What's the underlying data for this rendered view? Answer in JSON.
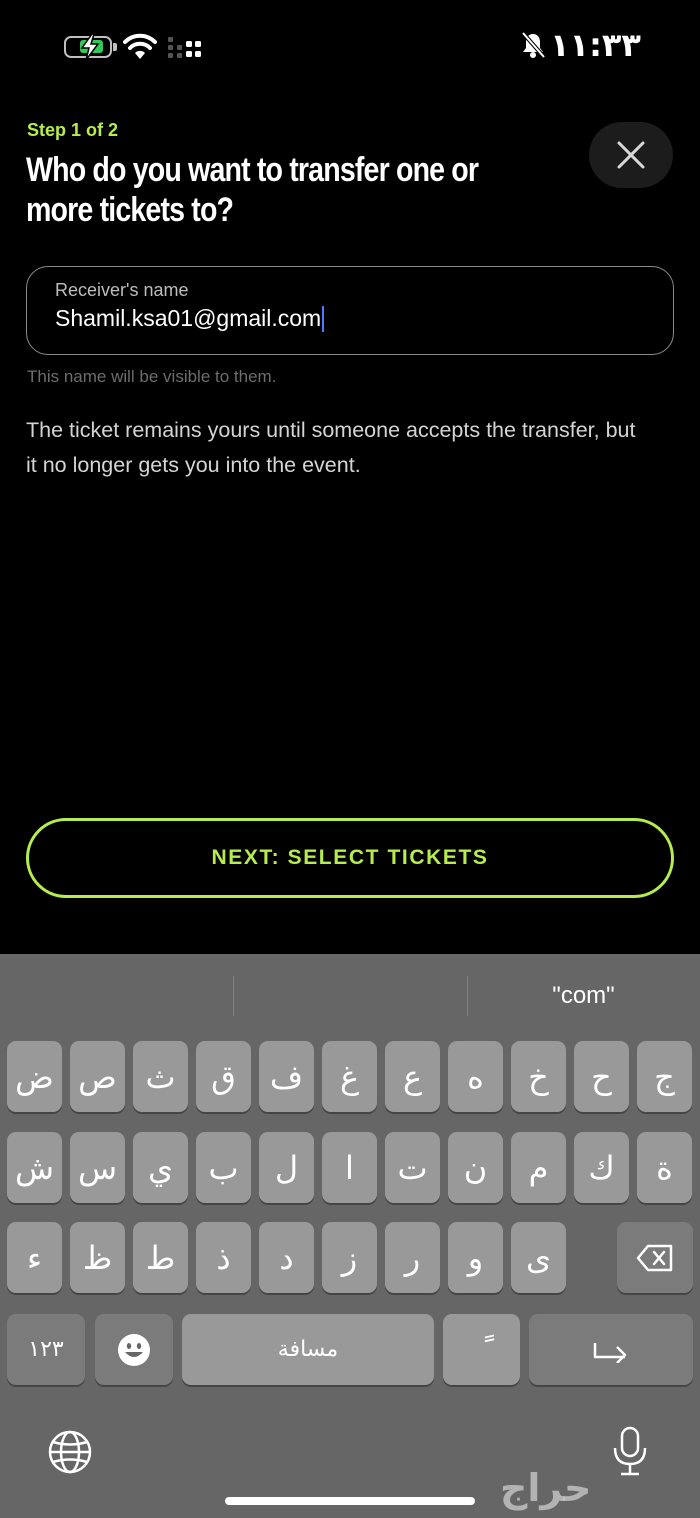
{
  "status": {
    "time": "١١:٣٣",
    "battery_charging": true,
    "icons": [
      "battery-charging-icon",
      "wifi-icon",
      "signal-icon",
      "bell-off-icon"
    ]
  },
  "header": {
    "step": "Step 1 of 2",
    "title": "Who do you want to transfer one or more tickets to?"
  },
  "form": {
    "label": "Receiver's name",
    "value": "Shamil.ksa01@gmail.com",
    "helper": "This name will be visible to them."
  },
  "info_text": "The ticket remains yours until someone accepts the transfer, but it no longer gets you into the event.",
  "next_button": "NEXT: SELECT TICKETS",
  "colors": {
    "accent": "#b5ec4e",
    "background": "#000000",
    "keyboard": "#666666"
  },
  "keyboard": {
    "suggestion": "\"com\"",
    "row1": [
      "ض",
      "ص",
      "ث",
      "ق",
      "ف",
      "غ",
      "ع",
      "ه",
      "خ",
      "ح",
      "ج"
    ],
    "row2": [
      "ش",
      "س",
      "ي",
      "ب",
      "ل",
      "ا",
      "ت",
      "ن",
      "م",
      "ك",
      "ة"
    ],
    "row3": [
      "ء",
      "ظ",
      "ط",
      "ذ",
      "د",
      "ز",
      "ر",
      "و",
      "ى"
    ],
    "numbers_key": "١٢٣",
    "space_key": "مسافة",
    "diacritic_key": "ًَ",
    "watermark": "حراج"
  }
}
